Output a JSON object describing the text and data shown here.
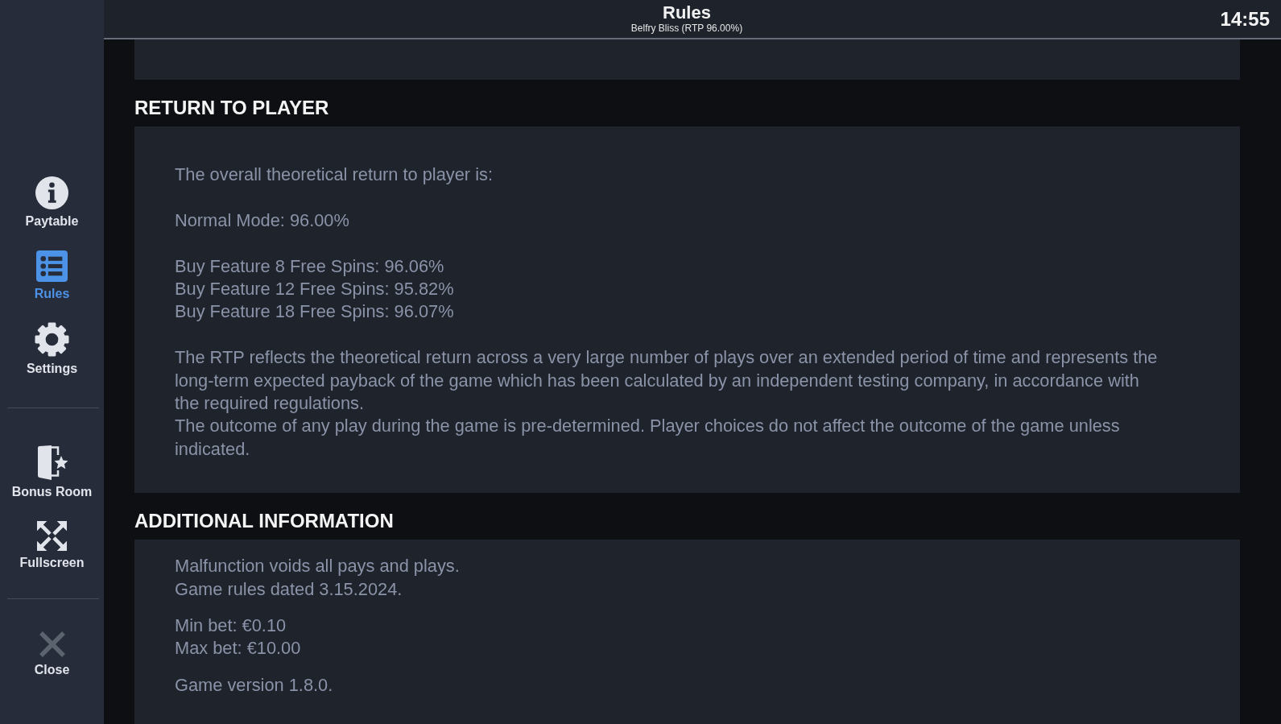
{
  "header": {
    "title": "Rules",
    "subtitle": "Belfry Bliss (RTP 96.00%)",
    "clock": "14:55"
  },
  "sidebar": {
    "groups": [
      {
        "items": [
          {
            "label": "Paytable",
            "selected": false
          },
          {
            "label": "Rules",
            "selected": true
          },
          {
            "label": "Settings",
            "selected": false
          }
        ]
      },
      {
        "items": [
          {
            "label": "Bonus Room",
            "selected": false
          },
          {
            "label": "Fullscreen",
            "selected": false
          }
        ]
      },
      {
        "items": [
          {
            "label": "Close",
            "selected": false
          }
        ]
      }
    ]
  },
  "sections": [
    {
      "heading": "RETURN TO PLAYER",
      "blocks": [
        [
          "The overall theoretical return to player is:"
        ],
        [
          "Normal Mode: 96.00%"
        ],
        [
          "Buy Feature 8 Free Spins: 96.06%",
          "Buy Feature 12 Free Spins: 95.82%",
          "Buy Feature 18 Free Spins: 96.07%"
        ],
        [
          "The RTP reflects the theoretical return across a very large number of plays over an extended period of time and represents the long-term expected payback of the game which has been calculated by an independent testing company, in accordance with the required regulations.",
          "The outcome of any play during the game is pre-determined. Player choices do not affect the outcome of the game unless indicated."
        ]
      ]
    },
    {
      "heading": "ADDITIONAL INFORMATION",
      "blocks": [
        [
          "Malfunction voids all pays and plays.",
          "Game rules dated 3.15.2024."
        ],
        [
          "Min bet: €0.10",
          "Max bet: €10.00"
        ],
        [
          "Game version 1.8.0."
        ]
      ]
    }
  ]
}
